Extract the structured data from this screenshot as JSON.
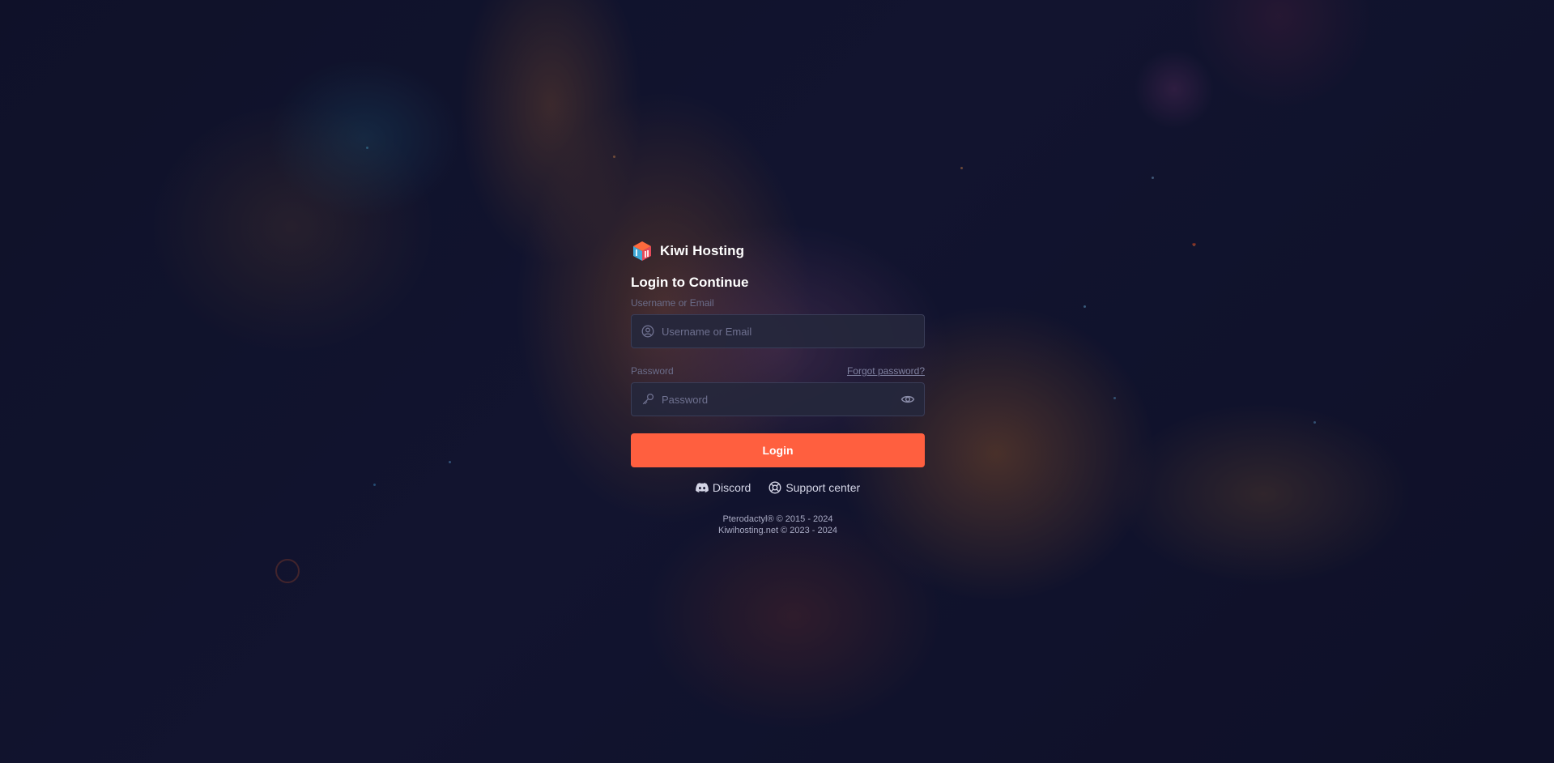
{
  "brand": {
    "name": "Kiwi Hosting",
    "logo_icon": "kiwi-cube-logo",
    "accent_color": "#ff5f3f"
  },
  "form": {
    "heading": "Login to Continue",
    "username": {
      "label": "Username or Email",
      "placeholder": "Username or Email",
      "value": "",
      "icon": "user-circle-icon"
    },
    "password": {
      "label": "Password",
      "placeholder": "Password",
      "value": "",
      "icon": "key-icon",
      "toggle_icon": "eye-icon"
    },
    "forgot_label": "Forgot password?",
    "submit_label": "Login"
  },
  "links": [
    {
      "label": "Discord",
      "icon": "discord-icon"
    },
    {
      "label": "Support center",
      "icon": "lifebuoy-icon"
    }
  ],
  "footer": {
    "line1": "Pterodactyl® © 2015 - 2024",
    "line2": "Kiwihosting.net © 2023 - 2024"
  }
}
